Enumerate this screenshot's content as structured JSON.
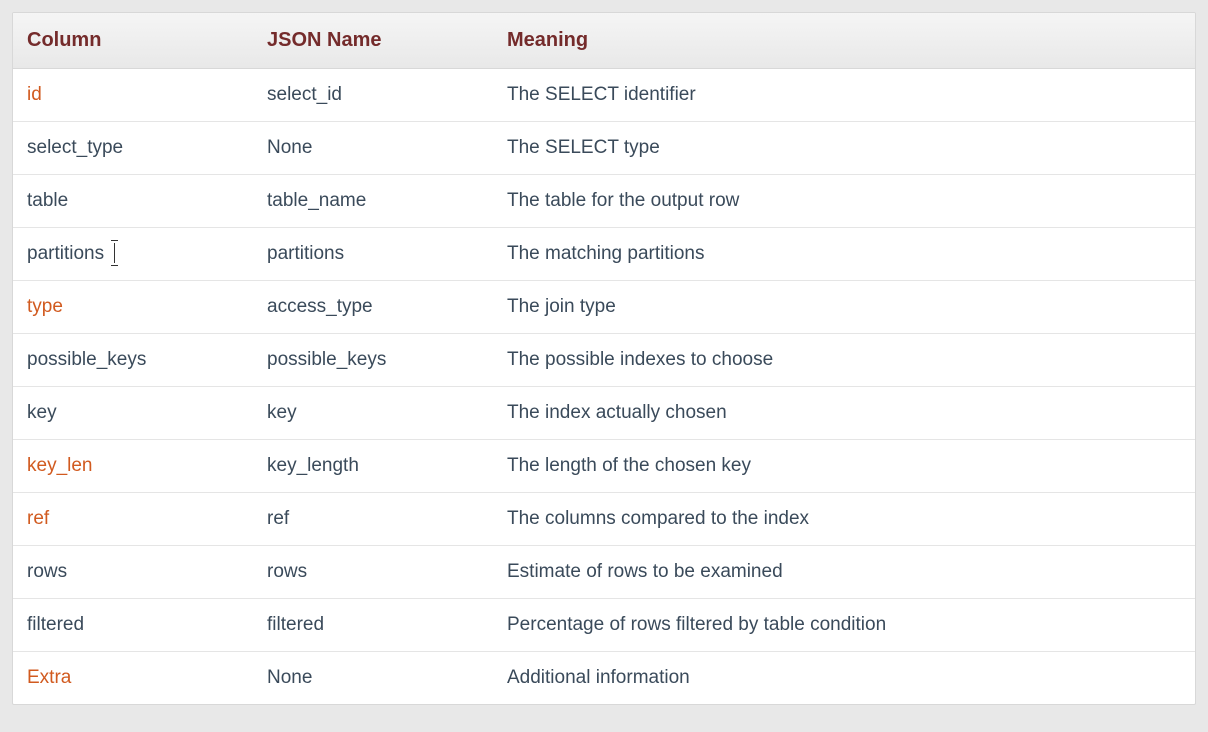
{
  "table": {
    "headers": {
      "column": "Column",
      "jsonName": "JSON Name",
      "meaning": "Meaning"
    },
    "rows": [
      {
        "column": "id",
        "isLink": true,
        "jsonName": "select_id",
        "meaning": "The SELECT  identifier",
        "hasCursor": false
      },
      {
        "column": "select_type",
        "isLink": false,
        "jsonName": "None",
        "meaning": "The SELECT  type",
        "hasCursor": false
      },
      {
        "column": "table",
        "isLink": false,
        "jsonName": "table_name",
        "meaning": "The table  for the output row",
        "hasCursor": false
      },
      {
        "column": "partitions",
        "isLink": false,
        "jsonName": "partitions",
        "meaning": "The  matching partitions",
        "hasCursor": true
      },
      {
        "column": "type",
        "isLink": true,
        "jsonName": "access_type",
        "meaning": "The join  type",
        "hasCursor": false
      },
      {
        "column": "possible_keys",
        "isLink": false,
        "jsonName": "possible_keys",
        "meaning": "The  possible indexes to choose",
        "hasCursor": false
      },
      {
        "column": "key",
        "isLink": false,
        "jsonName": "key",
        "meaning": "The index  actually chosen",
        "hasCursor": false
      },
      {
        "column": "key_len",
        "isLink": true,
        "jsonName": "key_length",
        "meaning": "The length  of the chosen key",
        "hasCursor": false
      },
      {
        "column": "ref",
        "isLink": true,
        "jsonName": "ref",
        "meaning": "The  columns compared to the index",
        "hasCursor": false
      },
      {
        "column": "rows",
        "isLink": false,
        "jsonName": "rows",
        "meaning": "Estimate  of rows to be examined",
        "hasCursor": false
      },
      {
        "column": "filtered",
        "isLink": false,
        "jsonName": "filtered",
        "meaning": "Percentage  of rows filtered by table condition",
        "hasCursor": false
      },
      {
        "column": "Extra",
        "isLink": true,
        "jsonName": "None",
        "meaning": "Additional  information",
        "hasCursor": false
      }
    ]
  }
}
